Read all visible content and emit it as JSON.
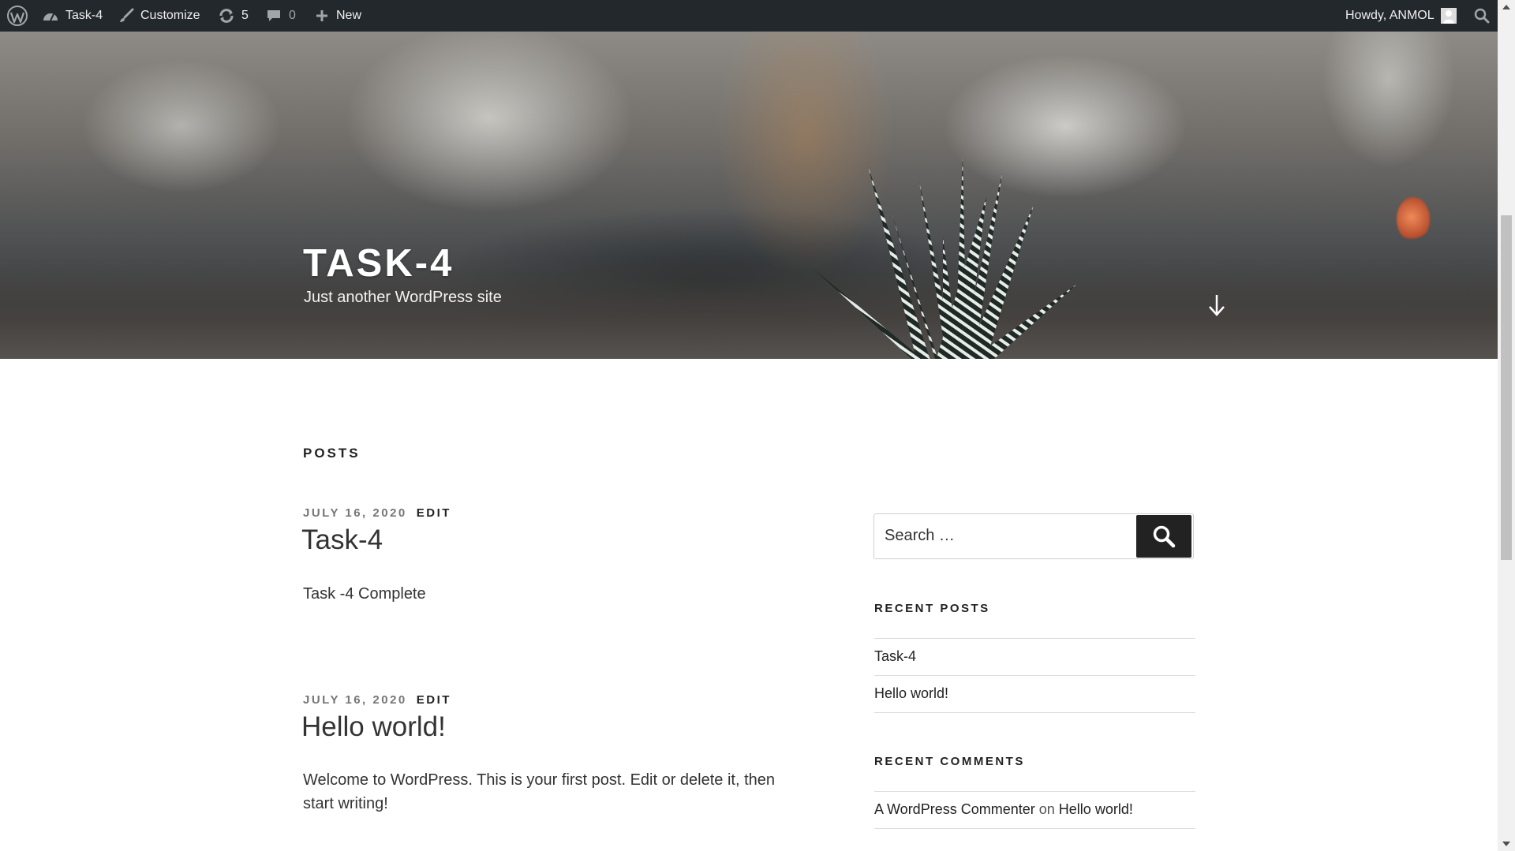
{
  "adminbar": {
    "site_name": "Task-4",
    "customize": "Customize",
    "updates_count": "5",
    "comments_count": "0",
    "new_label": "New",
    "howdy": "Howdy, ANMOL"
  },
  "header": {
    "site_title": "TASK-4",
    "tagline": "Just another WordPress site"
  },
  "main": {
    "heading": "POSTS",
    "posts": [
      {
        "date": "JULY 16, 2020",
        "edit": "EDIT",
        "title": "Task-4",
        "excerpt": "Task -4 Complete"
      },
      {
        "date": "JULY 16, 2020",
        "edit": "EDIT",
        "title": "Hello world!",
        "excerpt_line1": "Welcome to WordPress. This is your first post. Edit or delete it, then",
        "excerpt_line2": "start writing!"
      }
    ]
  },
  "sidebar": {
    "search_placeholder": "Search …",
    "recent_posts_title": "RECENT POSTS",
    "recent_posts": [
      "Task-4",
      "Hello world!"
    ],
    "recent_comments_title": "RECENT COMMENTS",
    "comment": {
      "author": "A WordPress Commenter",
      "on": "on",
      "post": "Hello world!"
    }
  },
  "colors": {
    "adminbar_bg": "#23282d",
    "text_dark": "#222222",
    "meta_gray": "#767676"
  }
}
